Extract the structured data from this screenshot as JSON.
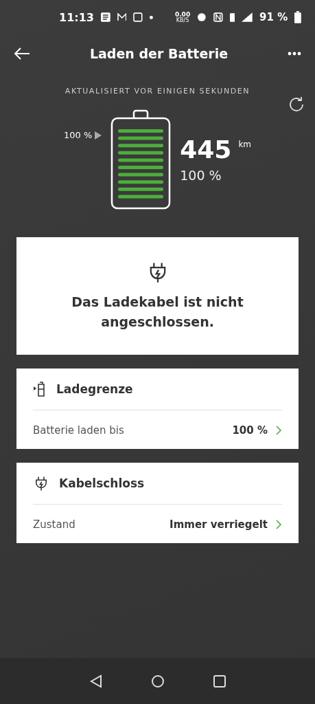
{
  "status_bar": {
    "time": "11:13",
    "data_rate": "0.00",
    "data_unit": "KB/S",
    "battery": "91 %"
  },
  "header": {
    "title": "Laden der Batterie"
  },
  "updated": "AKTUALISIERT VOR EINIGEN SEKUNDEN",
  "battery": {
    "limit_label": "100 %",
    "range": "445",
    "range_unit": "km",
    "percent": "100 %"
  },
  "message": {
    "text": "Das Ladekabel ist nicht angeschlossen."
  },
  "sections": [
    {
      "kind": "limit",
      "title": "Ladegrenze",
      "row": {
        "label": "Batterie laden bis",
        "value": "100 %"
      }
    },
    {
      "kind": "plug",
      "title": "Kabelschloss",
      "row": {
        "label": "Zustand",
        "value": "Immer verriegelt"
      }
    }
  ]
}
